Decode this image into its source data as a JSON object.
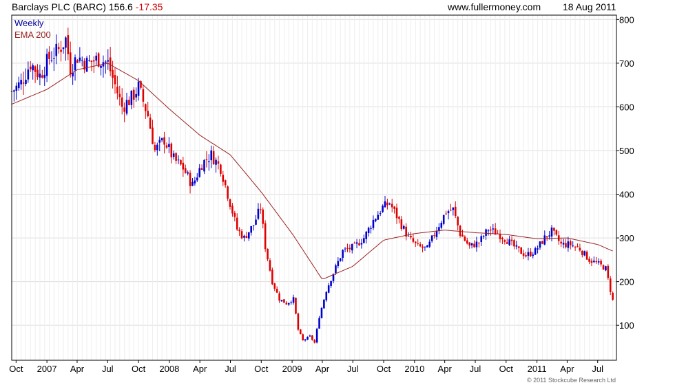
{
  "header": {
    "title": "Barclays PLC (BARC)",
    "price": "156.6",
    "change": "-17.35",
    "site": "www.fullermoney.com",
    "date": "18 Aug 2011"
  },
  "legend": {
    "period": "Weekly",
    "ema": "EMA 200"
  },
  "copyright": "© 2011 Stockcube Research Ltd",
  "colors": {
    "up": "#0000cc",
    "down": "#dd0000",
    "ema": "#992222",
    "grid": "#dddddd",
    "axis": "#000000",
    "legend_period": "#000099",
    "legend_ema": "#992222"
  },
  "chart_data": {
    "type": "candlestick",
    "title": "Barclays PLC (BARC)",
    "frequency": "weekly",
    "y_axis_side": "right",
    "ylim": [
      20,
      810
    ],
    "yticks": [
      100,
      200,
      300,
      400,
      500,
      600,
      700,
      800
    ],
    "x_range": [
      "2006-09-18",
      "2011-08-26"
    ],
    "xticks": [
      {
        "date": "2006-10-01",
        "label": "Oct"
      },
      {
        "date": "2007-01-01",
        "label": "2007"
      },
      {
        "date": "2007-04-01",
        "label": "Apr"
      },
      {
        "date": "2007-07-01",
        "label": "Jul"
      },
      {
        "date": "2007-10-01",
        "label": "Oct"
      },
      {
        "date": "2008-01-01",
        "label": "2008"
      },
      {
        "date": "2008-04-01",
        "label": "Apr"
      },
      {
        "date": "2008-07-01",
        "label": "Jul"
      },
      {
        "date": "2008-10-01",
        "label": "Oct"
      },
      {
        "date": "2009-01-01",
        "label": "2009"
      },
      {
        "date": "2009-04-01",
        "label": "Apr"
      },
      {
        "date": "2009-07-01",
        "label": "Jul"
      },
      {
        "date": "2009-10-01",
        "label": "Oct"
      },
      {
        "date": "2010-01-01",
        "label": "2010"
      },
      {
        "date": "2010-04-01",
        "label": "Apr"
      },
      {
        "date": "2010-07-01",
        "label": "Jul"
      },
      {
        "date": "2010-10-01",
        "label": "Oct"
      },
      {
        "date": "2011-01-01",
        "label": "2011"
      },
      {
        "date": "2011-04-01",
        "label": "Apr"
      },
      {
        "date": "2011-07-01",
        "label": "Jul"
      }
    ],
    "close_anchors": [
      [
        "2006-09-18",
        635
      ],
      [
        "2006-10-16",
        655
      ],
      [
        "2006-11-13",
        700
      ],
      [
        "2006-12-11",
        672
      ],
      [
        "2007-01-08",
        712
      ],
      [
        "2007-02-05",
        730
      ],
      [
        "2007-02-26",
        755
      ],
      [
        "2007-03-12",
        690
      ],
      [
        "2007-04-02",
        715
      ],
      [
        "2007-04-30",
        700
      ],
      [
        "2007-06-04",
        710
      ],
      [
        "2007-07-02",
        700
      ],
      [
        "2007-07-23",
        650
      ],
      [
        "2007-08-13",
        600
      ],
      [
        "2007-09-10",
        620
      ],
      [
        "2007-10-01",
        645
      ],
      [
        "2007-10-29",
        580
      ],
      [
        "2007-11-19",
        500
      ],
      [
        "2007-12-17",
        525
      ],
      [
        "2008-01-14",
        480
      ],
      [
        "2008-02-11",
        460
      ],
      [
        "2008-03-10",
        420
      ],
      [
        "2008-04-07",
        470
      ],
      [
        "2008-05-05",
        490
      ],
      [
        "2008-06-02",
        460
      ],
      [
        "2008-06-30",
        380
      ],
      [
        "2008-07-21",
        320
      ],
      [
        "2008-08-11",
        300
      ],
      [
        "2008-09-08",
        330
      ],
      [
        "2008-09-29",
        370
      ],
      [
        "2008-10-13",
        280
      ],
      [
        "2008-11-03",
        200
      ],
      [
        "2008-11-24",
        160
      ],
      [
        "2008-12-15",
        150
      ],
      [
        "2009-01-05",
        160
      ],
      [
        "2009-01-19",
        90
      ],
      [
        "2009-02-02",
        65
      ],
      [
        "2009-02-23",
        75
      ],
      [
        "2009-03-09",
        60
      ],
      [
        "2009-03-23",
        120
      ],
      [
        "2009-04-13",
        180
      ],
      [
        "2009-05-04",
        220
      ],
      [
        "2009-06-01",
        270
      ],
      [
        "2009-07-06",
        280
      ],
      [
        "2009-08-03",
        300
      ],
      [
        "2009-08-31",
        340
      ],
      [
        "2009-09-28",
        370
      ],
      [
        "2009-10-19",
        380
      ],
      [
        "2009-11-16",
        340
      ],
      [
        "2009-12-14",
        300
      ],
      [
        "2010-01-11",
        280
      ],
      [
        "2010-02-08",
        275
      ],
      [
        "2010-03-08",
        320
      ],
      [
        "2010-04-05",
        360
      ],
      [
        "2010-04-26",
        365
      ],
      [
        "2010-05-17",
        310
      ],
      [
        "2010-06-14",
        280
      ],
      [
        "2010-07-12",
        290
      ],
      [
        "2010-08-09",
        320
      ],
      [
        "2010-09-06",
        310
      ],
      [
        "2010-10-04",
        295
      ],
      [
        "2010-11-01",
        275
      ],
      [
        "2010-11-29",
        260
      ],
      [
        "2010-12-27",
        270
      ],
      [
        "2011-01-24",
        300
      ],
      [
        "2011-02-14",
        315
      ],
      [
        "2011-03-14",
        285
      ],
      [
        "2011-04-11",
        285
      ],
      [
        "2011-05-09",
        275
      ],
      [
        "2011-06-06",
        250
      ],
      [
        "2011-07-04",
        240
      ],
      [
        "2011-07-25",
        230
      ],
      [
        "2011-08-08",
        180
      ],
      [
        "2011-08-15",
        157
      ]
    ],
    "ema200_anchors": [
      [
        "2006-09-18",
        606
      ],
      [
        "2007-01-01",
        640
      ],
      [
        "2007-04-01",
        685
      ],
      [
        "2007-07-01",
        700
      ],
      [
        "2007-10-01",
        660
      ],
      [
        "2008-01-01",
        595
      ],
      [
        "2008-04-01",
        535
      ],
      [
        "2008-07-01",
        490
      ],
      [
        "2008-10-01",
        405
      ],
      [
        "2009-01-01",
        310
      ],
      [
        "2009-04-01",
        205
      ],
      [
        "2009-07-01",
        235
      ],
      [
        "2009-10-01",
        295
      ],
      [
        "2010-01-01",
        310
      ],
      [
        "2010-04-01",
        318
      ],
      [
        "2010-07-01",
        312
      ],
      [
        "2010-10-01",
        308
      ],
      [
        "2011-01-01",
        298
      ],
      [
        "2011-04-01",
        300
      ],
      [
        "2011-07-01",
        285
      ],
      [
        "2011-08-15",
        270
      ]
    ]
  }
}
